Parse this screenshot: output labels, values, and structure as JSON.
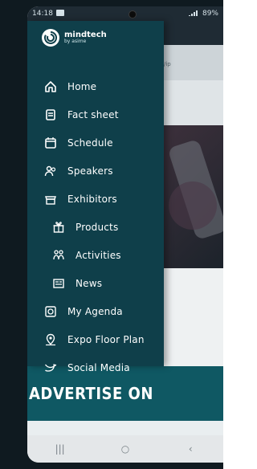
{
  "status_bar": {
    "time": "14:18",
    "battery": "89%"
  },
  "app": {
    "logo": {
      "name": "mindtech",
      "sub": "by asime"
    },
    "menu": [
      {
        "label": "Home",
        "icon": "home-icon"
      },
      {
        "label": "Fact sheet",
        "icon": "document-icon"
      },
      {
        "label": "Schedule",
        "icon": "calendar-icon"
      },
      {
        "label": "Speakers",
        "icon": "people-icon"
      },
      {
        "label": "Exhibitors",
        "icon": "store-icon"
      },
      {
        "label": "Products",
        "icon": "gift-icon"
      },
      {
        "label": "Activities",
        "icon": "activities-icon"
      },
      {
        "label": "News",
        "icon": "news-icon"
      },
      {
        "label": "My Agenda",
        "icon": "agenda-icon"
      },
      {
        "label": "Expo Floor Plan",
        "icon": "location-pin-icon"
      },
      {
        "label": "Social Media",
        "icon": "social-media-icon"
      }
    ]
  },
  "background": {
    "ad_text": "ADVERTISE ON",
    "top_fragment": "/ip"
  },
  "colors": {
    "drawer": "#0f3f4a",
    "ad": "#0f5863",
    "status": "#1f2b34"
  },
  "navbar": {
    "recent_label": "|||",
    "home_label": "○",
    "back_label": "‹"
  }
}
